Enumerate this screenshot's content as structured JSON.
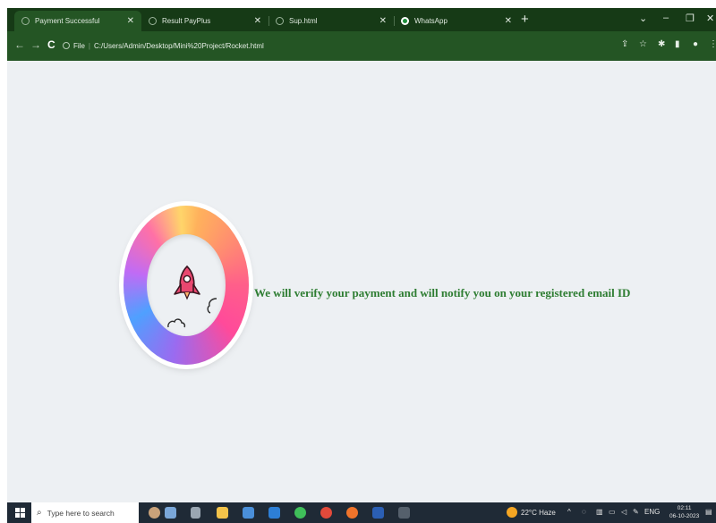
{
  "browser": {
    "tabs": [
      {
        "label": "Payment Successful",
        "active": true
      },
      {
        "label": "Result PayPlus",
        "active": false
      },
      {
        "label": "Sup.html",
        "active": false
      },
      {
        "label": "WhatsApp",
        "active": false
      }
    ],
    "new_tab_symbol": "+",
    "window_controls": {
      "chevron": "⌄",
      "minimize": "–",
      "restore": "❐",
      "close": "✕"
    },
    "address": {
      "scheme_label": "File",
      "url": "C:/Users/Admin/Desktop/Mini%20Project/Rocket.html"
    }
  },
  "page": {
    "message": "We will verify your payment and will notify you on your registered email ID",
    "icon": "rocket-icon",
    "colors": {
      "message": "#2e7d32",
      "background": "#edf0f3",
      "frame": "#1e4a1e"
    }
  },
  "taskbar": {
    "search_placeholder": "Type here to search",
    "weather": "22°C  Haze",
    "language": "ENG",
    "time": "02:11",
    "date": "06-10-2023"
  }
}
